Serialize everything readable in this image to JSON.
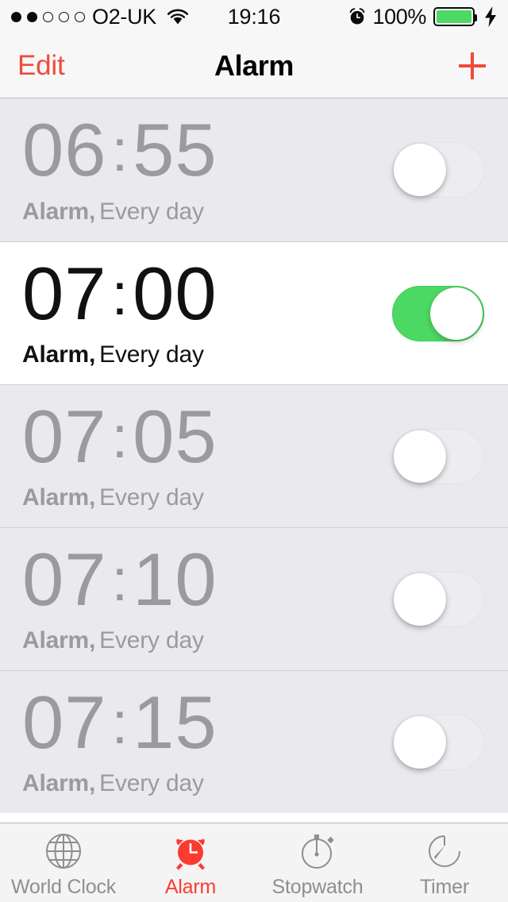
{
  "status_bar": {
    "signal_dots_filled": 2,
    "signal_dots_total": 5,
    "carrier": "O2-UK",
    "wifi_icon": "wifi-icon",
    "time": "19:16",
    "alarm_icon": "alarm-badge-icon",
    "battery_percent": "100%",
    "battery_level": 100,
    "charging": true,
    "battery_color": "#4cd964"
  },
  "nav": {
    "edit_label": "Edit",
    "title": "Alarm",
    "add_icon": "plus-icon",
    "accent_color": "#f04a3c"
  },
  "alarms": [
    {
      "time": "06",
      "minute": "55",
      "label": "Alarm,",
      "repeat": "Every day",
      "enabled": false
    },
    {
      "time": "07",
      "minute": "00",
      "label": "Alarm,",
      "repeat": "Every day",
      "enabled": true
    },
    {
      "time": "07",
      "minute": "05",
      "label": "Alarm,",
      "repeat": "Every day",
      "enabled": false
    },
    {
      "time": "07",
      "minute": "10",
      "label": "Alarm,",
      "repeat": "Every day",
      "enabled": false
    },
    {
      "time": "07",
      "minute": "15",
      "label": "Alarm,",
      "repeat": "Every day",
      "enabled": false
    }
  ],
  "toggle_on_color": "#4bd863",
  "tabs": [
    {
      "label": "World Clock",
      "icon": "globe-icon",
      "active": false
    },
    {
      "label": "Alarm",
      "icon": "alarm-clock-icon",
      "active": true
    },
    {
      "label": "Stopwatch",
      "icon": "stopwatch-icon",
      "active": false
    },
    {
      "label": "Timer",
      "icon": "timer-icon",
      "active": false
    }
  ],
  "tab_active_color": "#fb3b30",
  "tab_inactive_color": "#8e8e93"
}
